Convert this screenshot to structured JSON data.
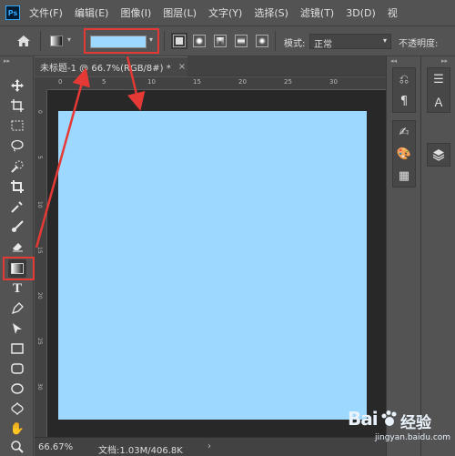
{
  "app": {
    "logo_text": "Ps",
    "menu": [
      "文件(F)",
      "编辑(E)",
      "图像(I)",
      "图层(L)",
      "文字(Y)",
      "选择(S)",
      "滤镜(T)",
      "3D(D)",
      "视"
    ]
  },
  "options_bar": {
    "home_icon": "home-icon",
    "gradient_color": "#9cd8ff",
    "gradient_types": [
      "linear",
      "radial",
      "angle",
      "reflected",
      "diamond"
    ],
    "active_gradient_type": "linear",
    "mode_label": "模式:",
    "mode_value": "正常",
    "opacity_label": "不透明度:"
  },
  "document": {
    "tab_title": "未标题-1 @ 66.7%(RGB/8#) *",
    "tab_close": "×",
    "ruler_h": [
      "0",
      "5",
      "10",
      "15",
      "20",
      "25",
      "30"
    ],
    "ruler_v": [
      "0",
      "5",
      "10",
      "15",
      "20",
      "25",
      "30"
    ],
    "canvas_color": "#9cd8ff"
  },
  "status": {
    "zoom": "66.67%",
    "doc_info": "文档:1.03M/406.8K",
    "caret": "›"
  },
  "toolbar": {
    "active_tool": "gradient-tool",
    "collapse_glyph": "▸▸"
  },
  "right_panels": {
    "collapse_a": "◂◂",
    "collapse_b": "▸▸"
  },
  "watermark": {
    "brand": "Bai",
    "brand2": "经验",
    "url": "jingyan.baidu.com"
  },
  "colors": {
    "accent_red": "#e53935",
    "ui_bg": "#535353",
    "workspace": "#282828"
  }
}
